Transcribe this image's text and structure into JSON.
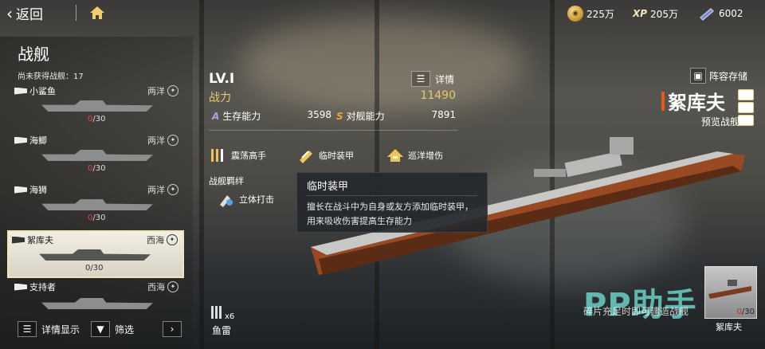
{
  "topbar": {
    "back_label": "返回",
    "resources": [
      {
        "icon": "gold-coin-icon",
        "value": "225万"
      },
      {
        "icon": "xp-icon",
        "icon_text": "XP",
        "value": "205万"
      },
      {
        "icon": "ticket-icon",
        "value": "6002"
      }
    ]
  },
  "left": {
    "title": "战舰",
    "unobtained_label": "尚未获得战舰：17",
    "ships": [
      {
        "name": "小鲨鱼",
        "region": "两洋",
        "owned": "0",
        "total": "/30"
      },
      {
        "name": "海鲫",
        "region": "两洋",
        "owned": "0",
        "total": "/30"
      },
      {
        "name": "海狮",
        "region": "两洋",
        "owned": "0",
        "total": "/30"
      },
      {
        "name": "絮库夫",
        "region": "西海",
        "owned": "0",
        "total": "/30"
      },
      {
        "name": "支持者",
        "region": "西海",
        "owned": "",
        "total": ""
      }
    ],
    "detail_display_label": "详情显示",
    "filter_label": "筛选"
  },
  "stats": {
    "level": "LV.I",
    "details_label": "详情",
    "power_label": "战力",
    "power_value": "11490",
    "survival_tag": "A",
    "survival_label": "生存能力",
    "survival_value": "3598",
    "anti_ship_tag": "S",
    "anti_ship_label": "对舰能力",
    "anti_ship_value": "7891",
    "skills": [
      {
        "label": "震荡高手"
      },
      {
        "label": "临时装甲"
      },
      {
        "label": "巡洋增伤"
      }
    ],
    "bond_label": "战舰羁绊",
    "bond_skill": "立体打击",
    "torpedo_count": "x6",
    "torpedo_label": "鱼雷"
  },
  "tooltip": {
    "title": "临时装甲",
    "body": "擅长在战斗中为自身或友方添加临时装甲，用来吸收伤害提高生存能力"
  },
  "right": {
    "formation_label": "阵容存储",
    "ship_name": "絮库夫",
    "preview_label": "预览战舰",
    "fragment_hint": "碎片充足时即可建造战舰",
    "mini_owned": "0",
    "mini_total": "/30",
    "mini_label": "絮库夫"
  },
  "watermark": "PP助手",
  "colors": {
    "accent_gold": "#e4c970",
    "danger": "#e0463c",
    "name_bar": "#e25a1f"
  }
}
